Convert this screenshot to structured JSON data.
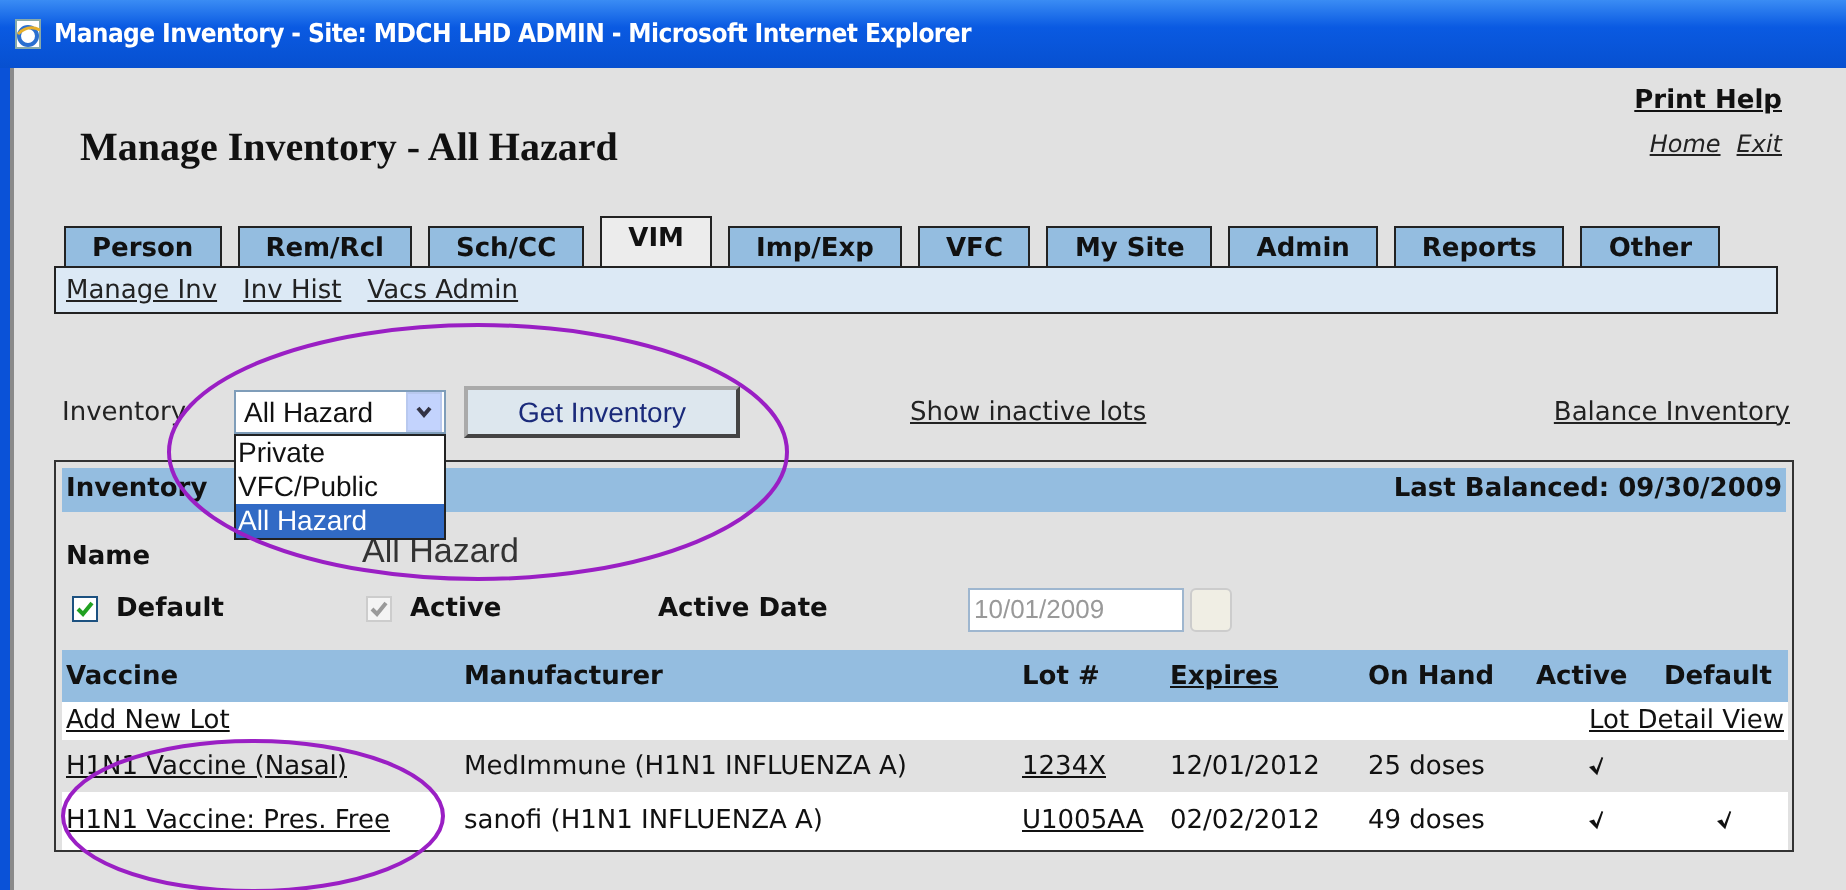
{
  "window": {
    "title": "Manage Inventory - Site: MDCH LHD ADMIN - Microsoft Internet Explorer"
  },
  "header": {
    "title": "Manage Inventory - All Hazard",
    "print_help": "Print Help",
    "home": "Home",
    "exit": "Exit"
  },
  "tabs": [
    {
      "label": "Person",
      "selected": false
    },
    {
      "label": "Rem/Rcl",
      "selected": false
    },
    {
      "label": "Sch/CC",
      "selected": false
    },
    {
      "label": "VIM",
      "selected": true
    },
    {
      "label": "Imp/Exp",
      "selected": false
    },
    {
      "label": "VFC",
      "selected": false
    },
    {
      "label": "My Site",
      "selected": false
    },
    {
      "label": "Admin",
      "selected": false
    },
    {
      "label": "Reports",
      "selected": false
    },
    {
      "label": "Other",
      "selected": false
    }
  ],
  "subnav": [
    "Manage Inv",
    "Inv Hist",
    "Vacs Admin"
  ],
  "inventory_bar": {
    "label": "Inventory",
    "select_value": "All Hazard",
    "dropdown": [
      {
        "label": "Private",
        "selected": false
      },
      {
        "label": "VFC/Public",
        "selected": false
      },
      {
        "label": "All Hazard",
        "selected": true
      }
    ],
    "button": "Get Inventory",
    "show_inactive": "Show inactive lots",
    "balance": "Balance Inventory"
  },
  "panel": {
    "header": "Inventory",
    "last_balanced": "Last Balanced: 09/30/2009",
    "name_label": "Name",
    "name_value": "All Hazard",
    "default": {
      "label": "Default",
      "checked": true,
      "disabled": false
    },
    "active": {
      "label": "Active",
      "checked": true,
      "disabled": true
    },
    "active_date": {
      "label": "Active Date",
      "value": "10/01/2009",
      "disabled": true
    }
  },
  "table": {
    "columns": [
      {
        "label": "Vaccine",
        "link": false
      },
      {
        "label": "Manufacturer",
        "link": false
      },
      {
        "label": "Lot #",
        "link": false
      },
      {
        "label": "Expires",
        "link": true
      },
      {
        "label": "On Hand",
        "link": false
      },
      {
        "label": "Active",
        "link": false
      },
      {
        "label": "Default",
        "link": false
      }
    ],
    "add_new_lot": "Add New Lot",
    "lot_detail_view": "Lot Detail View",
    "rows": [
      {
        "vaccine": "H1N1 Vaccine (Nasal)",
        "manufacturer": "MedImmune (H1N1 INFLUENZA A)",
        "lot": "1234X",
        "expires": "12/01/2012",
        "on_hand": "25 doses",
        "active": true,
        "default": false
      },
      {
        "vaccine": "H1N1 Vaccine: Pres. Free",
        "manufacturer": "sanofi (H1N1 INFLUENZA A)",
        "lot": "U1005AA",
        "expires": "02/02/2012",
        "on_hand": "49 doses",
        "active": true,
        "default": true
      }
    ]
  },
  "annotations": [
    {
      "kind": "ellipse"
    },
    {
      "kind": "ellipse"
    }
  ]
}
